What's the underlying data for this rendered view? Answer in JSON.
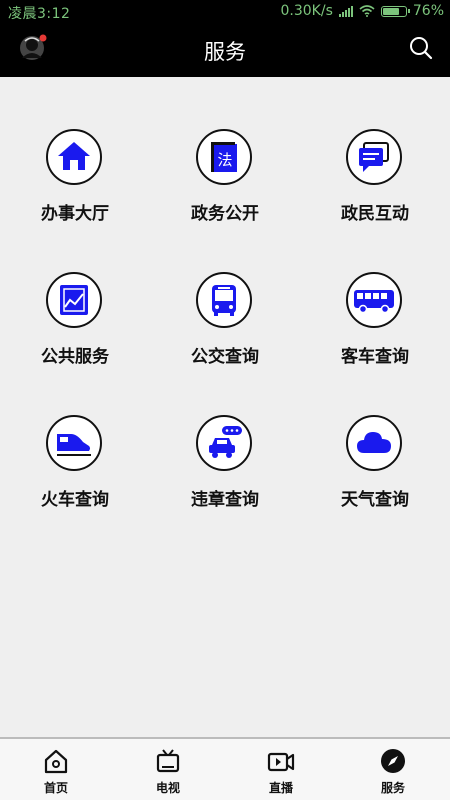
{
  "status": {
    "time": "凌晨3:12",
    "speed": "0.30K/s",
    "battery": "76%",
    "battery_level": 0.76
  },
  "header": {
    "title": "服务"
  },
  "services": [
    {
      "label": "办事大厅",
      "icon": "house-icon"
    },
    {
      "label": "政务公开",
      "icon": "law-book-icon"
    },
    {
      "label": "政民互动",
      "icon": "chat-bubbles-icon"
    },
    {
      "label": "公共服务",
      "icon": "chart-icon"
    },
    {
      "label": "公交查询",
      "icon": "bus-front-icon"
    },
    {
      "label": "客车查询",
      "icon": "coach-bus-icon"
    },
    {
      "label": "火车查询",
      "icon": "train-icon"
    },
    {
      "label": "违章查询",
      "icon": "car-violation-icon"
    },
    {
      "label": "天气查询",
      "icon": "cloud-icon"
    }
  ],
  "tabs": [
    {
      "label": "首页",
      "icon": "home-icon"
    },
    {
      "label": "电视",
      "icon": "tv-icon"
    },
    {
      "label": "直播",
      "icon": "live-video-icon"
    },
    {
      "label": "服务",
      "icon": "compass-icon",
      "active": true
    }
  ],
  "colors": {
    "accent_blue": "#1a1aee",
    "header_bg": "#000000",
    "page_bg": "#efefef"
  }
}
